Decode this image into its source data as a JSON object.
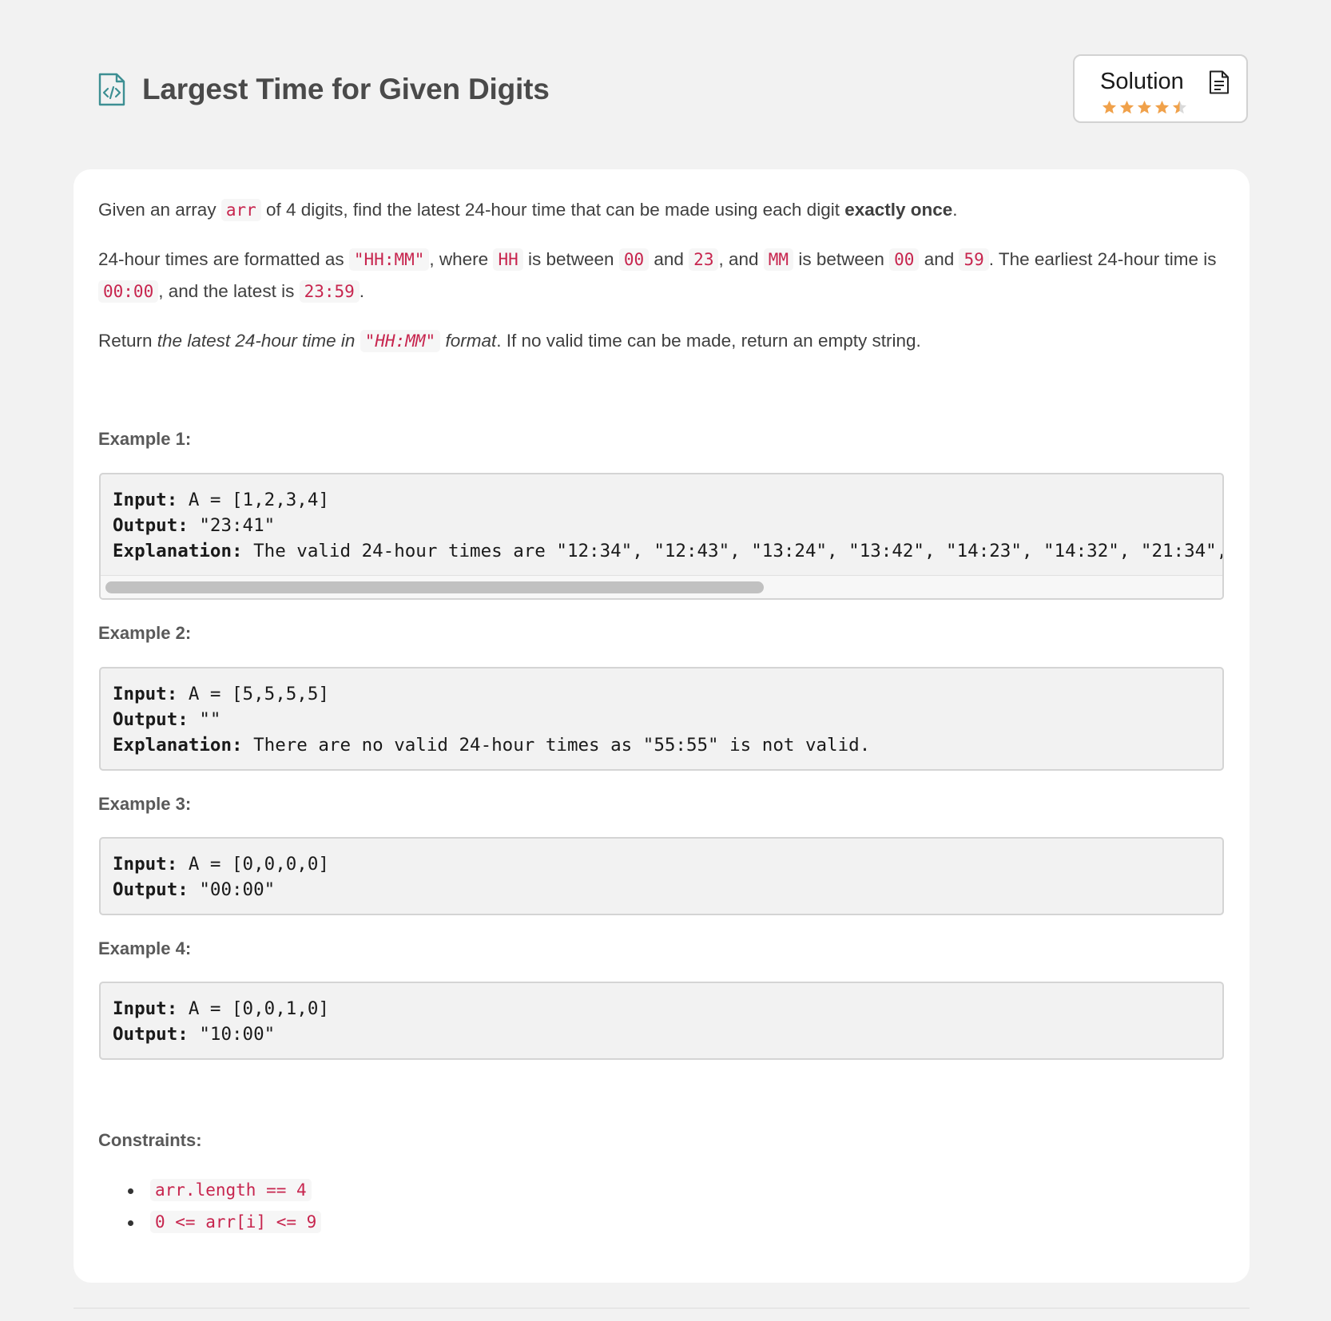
{
  "header": {
    "title": "Largest Time for Given Digits",
    "solution_label": "Solution",
    "rating": 4.5
  },
  "description": {
    "p1": {
      "before": "Given an array ",
      "code": "arr",
      "middle": " of 4 digits, find the latest 24-hour time that can be made using each digit ",
      "bold": "exactly once",
      "after": "."
    },
    "p2": {
      "t1": "24-hour times are formatted as ",
      "c1": "\"HH:MM\"",
      "t2": ", where ",
      "c2": "HH",
      "t3": " is between ",
      "c3": "00",
      "t4": " and ",
      "c4": "23",
      "t5": ", and ",
      "c5": "MM",
      "t6": " is between ",
      "c6": "00",
      "t7": " and ",
      "c7": "59",
      "t8": ". The earliest 24-hour time is ",
      "c8": "00:00",
      "t9": ", and the latest is ",
      "c9": "23:59",
      "t10": "."
    },
    "p3": {
      "t1": "Return ",
      "i1": "the latest 24-hour time in ",
      "c1": "\"HH:MM\"",
      "i2": " format",
      "t2": ".  If no valid time can be made, return an empty string."
    }
  },
  "examples": [
    {
      "title": "Example 1:",
      "input_label": "Input:",
      "input": " A = [1,2,3,4]",
      "output_label": "Output:",
      "output": " \"23:41\"",
      "explanation_label": "Explanation:",
      "explanation": " The valid 24-hour times are \"12:34\", \"12:43\", \"13:24\", \"13:42\", \"14:23\", \"14:32\", \"21:34\","
    },
    {
      "title": "Example 2:",
      "input_label": "Input:",
      "input": " A = [5,5,5,5]",
      "output_label": "Output:",
      "output": " \"\"",
      "explanation_label": "Explanation:",
      "explanation": " There are no valid 24-hour times as \"55:55\" is not valid."
    },
    {
      "title": "Example 3:",
      "input_label": "Input:",
      "input": " A = [0,0,0,0]",
      "output_label": "Output:",
      "output": " \"00:00\""
    },
    {
      "title": "Example 4:",
      "input_label": "Input:",
      "input": " A = [0,0,1,0]",
      "output_label": "Output:",
      "output": " \"10:00\""
    }
  ],
  "constraints": {
    "title": "Constraints:",
    "items": [
      "arr.length == 4",
      "0 <= arr[i] <= 9"
    ]
  },
  "colors": {
    "accent_icon": "#3d8f93",
    "star": "#f0a14a",
    "star_empty": "#d9d9d9",
    "code_text": "#c7254e"
  }
}
